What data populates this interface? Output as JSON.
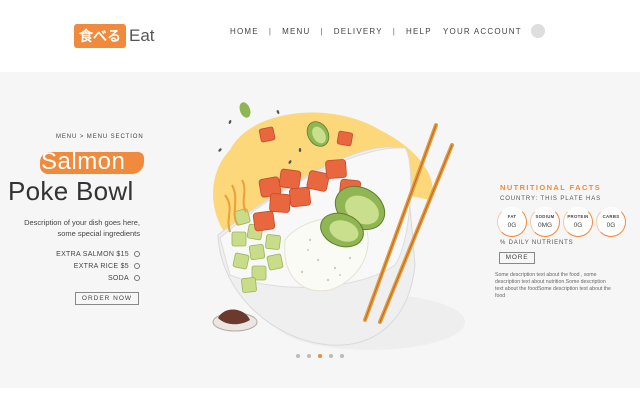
{
  "header": {
    "logo_badge": "食べる",
    "logo_text": "Eat",
    "nav": [
      "HOME",
      "MENU",
      "DELIVERY",
      "HELP"
    ],
    "nav_separator": "|",
    "account_label": "YOUR ACCOUNT"
  },
  "hero": {
    "breadcrumb": "MENU > MENU SECTION",
    "dish_highlight": "Salmon",
    "dish_title": "Poke Bowl",
    "description": "Description of your dish goes here, some special ingredients",
    "extras": [
      "EXTRA SALMON $15",
      "EXTRA RICE $5",
      "SODA"
    ],
    "order_button": "ORDER NOW",
    "slides": {
      "count": 5,
      "active": 3
    }
  },
  "nutrition": {
    "title": "NUTRITIONAL FACTS",
    "country": "COUNTRY: THIS PLATE HAS",
    "items": [
      {
        "label": "FAT",
        "value": "0G"
      },
      {
        "label": "SODIUM",
        "value": "0MG"
      },
      {
        "label": "PROTEIN",
        "value": "0G"
      },
      {
        "label": "CARBS",
        "value": "0G"
      }
    ],
    "daily_label": "% DAILY NUTRIENTS",
    "more_button": "MORE",
    "description": "Some description text about the food , some description text about nutrition.Some description text about the foodSome description text about the food"
  },
  "colors": {
    "accent": "#f08a3c",
    "hero_background": "#f6f6f6",
    "text": "#333333"
  },
  "icons": [
    "user-avatar-icon",
    "radio-icon",
    "poke-bowl-illustration",
    "chopsticks-icon",
    "soy-sauce-dish-icon"
  ]
}
